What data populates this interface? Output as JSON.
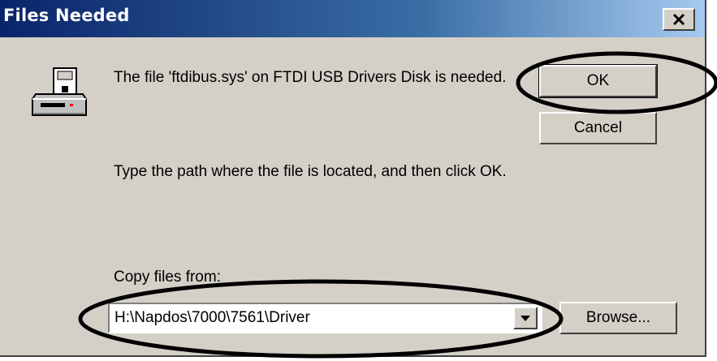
{
  "window": {
    "title": "Files Needed",
    "close_icon": "close-icon"
  },
  "message": {
    "line1": "The file 'ftdibus.sys' on FTDI USB Drivers Disk is needed.",
    "line2": "Type the path where the file is located, and then click OK."
  },
  "copy_from": {
    "label": "Copy files from:",
    "value": "H:\\Napdos\\7000\\7561\\Driver"
  },
  "buttons": {
    "ok": "OK",
    "cancel": "Cancel",
    "browse": "Browse..."
  },
  "icons": {
    "drive": "floppy-drive-icon",
    "dropdown": "dropdown-arrow-icon"
  },
  "colors": {
    "title_gradient_start": "#0a246a",
    "title_gradient_end": "#a6caf0",
    "dialog_face": "#d4d0c8"
  }
}
